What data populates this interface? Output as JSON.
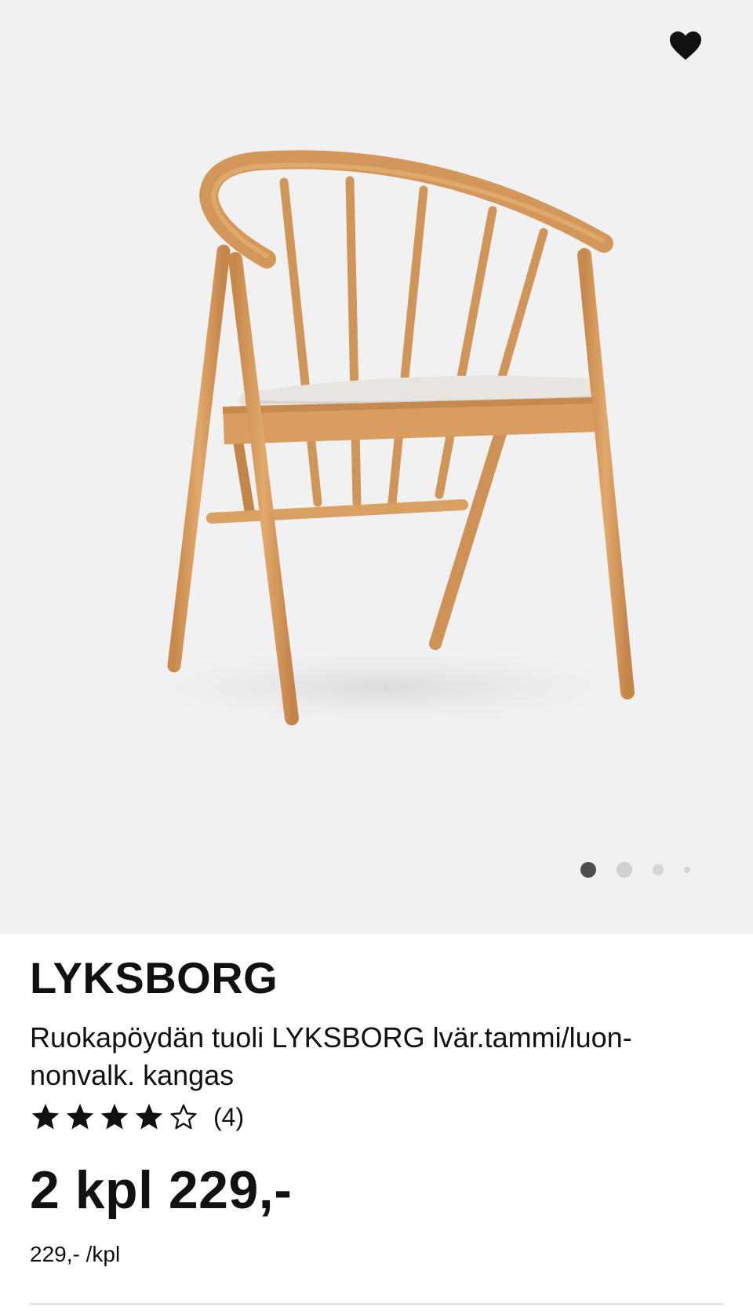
{
  "product": {
    "brand": "LYKSBORG",
    "description": "Ruokapöydän tuoli LYKSBORG lvär.tammi/luon-nonvalk. kangas",
    "rating": {
      "stars": 4,
      "max_stars": 5,
      "count_text": "(4)"
    },
    "price": "2 kpl 229,-",
    "unit_price": "229,- /kpl"
  },
  "gallery": {
    "active_index": 1,
    "total_dots": 4
  },
  "icons": {
    "favorite": "heart-icon",
    "star_filled": "star-filled-icon",
    "star_empty": "star-outline-icon"
  },
  "colors": {
    "hero_background": "#f2f1f2",
    "text": "#111111",
    "dot_active": "#4d4d4d",
    "dot_inactive": "#d0d0d0"
  }
}
